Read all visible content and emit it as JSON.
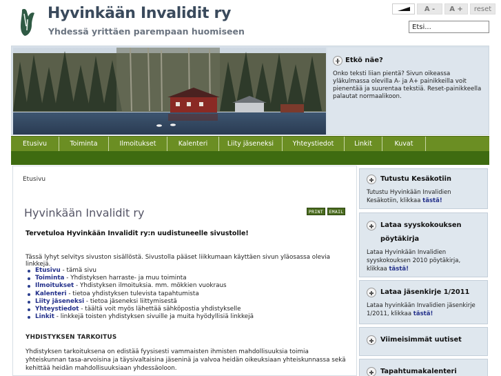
{
  "header": {
    "title": "Hyvinkään Invalidit ry",
    "slogan": "Yhdessä yrittäen parempaan huomiseen",
    "logo_icon": "stylized-hand-logo"
  },
  "font_tools": {
    "font_minus": "A -",
    "font_plus": "A +",
    "reset": "reset"
  },
  "search": {
    "value": "Etsi..."
  },
  "banner_info": {
    "title": "Etkö näe?",
    "text": "Onko teksti liian pientä? Sivun oikeassa yläkulmassa olevilla A- ja A+ painikkeilla voit pienentää ja suurentaa tekstiä. Reset-painikkeella palautat normaalikoon."
  },
  "nav": {
    "items": [
      "Etusivu",
      "Toiminta",
      "Ilmoitukset",
      "Kalenteri",
      "Liity jäseneksi",
      "Yhteystiedot",
      "Linkit",
      "Kuvat"
    ]
  },
  "main": {
    "breadcrumb": "Etusivu",
    "page_title": "Hyvinkään Invalidit ry",
    "print_label": "PRINT",
    "email_label": "EMAIL",
    "lead": "Tervetuloa Hyvinkään Invalidit ry:n uudistuneelle sivustolle!",
    "intro": "Tässä lyhyt selvitys sivuston sisällöstä. Sivustolla pääset liikkumaan käyttäen sivun yläosassa olevia linkkejä.",
    "links": [
      {
        "label": "Etusivu",
        "desc": " - tämä sivu"
      },
      {
        "label": "Toiminta",
        "desc": " - Yhdistyksen harraste- ja muu toiminta"
      },
      {
        "label": "Ilmoitukset",
        "desc": " - Yhdistyksen ilmoituksia. mm. mökkien vuokraus"
      },
      {
        "label": "Kalenteri",
        "desc": " - tietoa yhdistyksen tulevista tapahtumista"
      },
      {
        "label": "Liity jäseneksi",
        "desc": " - tietoa jäseneksi liittymisestä"
      },
      {
        "label": "Yhteystiedot",
        "desc": " - täältä voit myös lähettää sähköpostia yhdistykselle"
      },
      {
        "label": "Linkit",
        "desc": " - linkkejä toisten yhdistyksen sivuille ja muita hyödyllisiä linkkejä"
      }
    ],
    "section_title": "YHDISTYKSEN TARKOITUS",
    "section_body": "Yhdistyksen tarkoituksena on edistää fyysisesti vammaisten ihmisten mahdollisuuksia toimia yhteiskunnan tasa-arvoisina ja täysivaltaisina jäseninä ja valvoa heidän oikeuksiaan yhteiskunnassa sekä kehittää heidän mahdollisuuksiaan yhdessäoloon."
  },
  "sidebar": {
    "boxes": [
      {
        "title": "Tutustu Kesäkotiin",
        "text": "Tutustu Hyvinkään Invalidien Kesäkotiin, klikkaa ",
        "link": "tästä!"
      },
      {
        "title": "Lataa syyskokouksen pöytäkirja",
        "text": "Lataa Hyvinkään Invalidien syyskokouksen 2010 pöytäkirja, klikkaa ",
        "link": "tästä!"
      },
      {
        "title": "Lataa jäsenkirje 1/2011",
        "text": "Lataa hyvinkään Invalidien jäsenkirje 1/2011, klikkaa ",
        "link": "tästä!"
      },
      {
        "title": "Viimeisimmät uutiset",
        "text": "",
        "link": ""
      },
      {
        "title": "Tapahtumakalenteri",
        "text": "",
        "link": ""
      }
    ]
  },
  "colors": {
    "nav_green": "#6b8e23",
    "nav_dark_green": "#3e6b10",
    "link_blue": "#23308a",
    "sidebar_bg": "#dfe7ee"
  }
}
